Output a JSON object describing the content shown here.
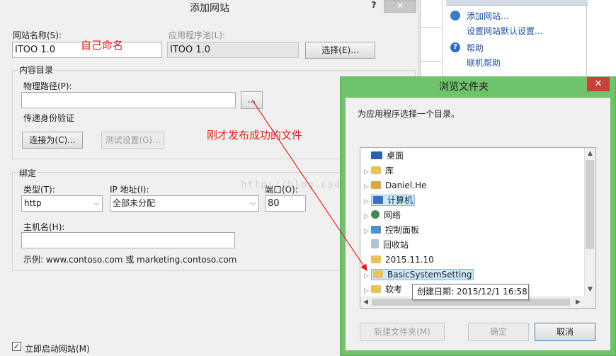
{
  "add_site": {
    "title": "添加网站",
    "help": "?",
    "site_name_label": "网站名称(S):",
    "site_name_value": "ITOO 1.0",
    "app_pool_label": "应用程序池(L):",
    "app_pool_value": "ITOO 1.0",
    "select_button": "选择(E)...",
    "content_dir_label": "内容目录",
    "physical_path_label": "物理路径(P):",
    "physical_path_value": "",
    "browse_button": "...",
    "pass_auth_label": "传递身份验证",
    "connect_as_button": "连接为(C)...",
    "test_settings_button": "测试设置(G)...",
    "binding_label": "绑定",
    "type_label": "类型(T):",
    "type_value": "http",
    "ip_label": "IP 地址(I):",
    "ip_value": "全部未分配",
    "port_label": "端口(O):",
    "port_value": "80",
    "host_label": "主机名(H):",
    "host_value": "",
    "example_text": "示例: www.contoso.com 或 marketing.contoso.com",
    "autostart_label": "立即启动网站(M)",
    "autostart_checked": "✓"
  },
  "annotations": {
    "self_named": "自己命名",
    "just_published": "刚才发布成功的文件",
    "watermark": "http://blog.csdn.net/"
  },
  "actions_panel": {
    "links": [
      "添加网站...",
      "设置网站默认设置...",
      "帮助",
      "联机帮助"
    ]
  },
  "browse_dialog": {
    "title": "浏览文件夹",
    "prompt": "为应用程序选择一个目录。",
    "tree": [
      {
        "label": "桌面",
        "icon": "desktop-icon",
        "arrow": ""
      },
      {
        "label": "库",
        "icon": "library-icon",
        "arrow": "▷"
      },
      {
        "label": "Daniel.He",
        "icon": "user-folder-icon",
        "arrow": "▷"
      },
      {
        "label": "计算机",
        "icon": "computer-icon",
        "arrow": "▷"
      },
      {
        "label": "网络",
        "icon": "network-icon",
        "arrow": "▷"
      },
      {
        "label": "控制面板",
        "icon": "control-panel-icon",
        "arrow": "▷"
      },
      {
        "label": "回收站",
        "icon": "recycle-bin-icon",
        "arrow": ""
      },
      {
        "label": "2015.11.10",
        "icon": "folder-icon",
        "arrow": ""
      },
      {
        "label": "BasicSystemSetting",
        "icon": "folder-icon",
        "arrow": "▷"
      },
      {
        "label": "软考",
        "icon": "folder-icon",
        "arrow": "▷"
      }
    ],
    "tooltip": "创建日期: 2015/12/1 16:58",
    "new_folder_button": "新建文件夹(M)",
    "ok_button": "确定",
    "cancel_button": "取消"
  },
  "colors": {
    "annotation_red": "#e2201c",
    "browse_frame_green": "#6fc36a",
    "link_blue": "#1f4fa3"
  }
}
